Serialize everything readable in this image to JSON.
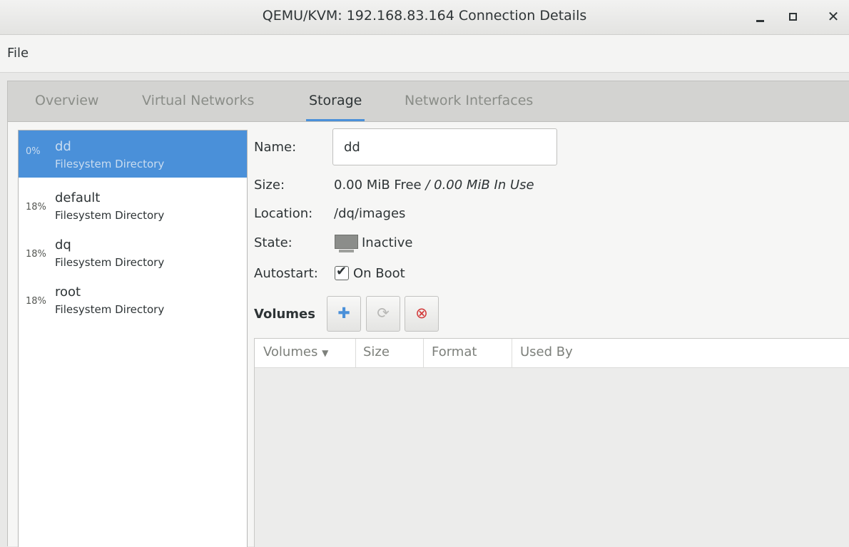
{
  "window": {
    "title": "QEMU/KVM: 192.168.83.164 Connection Details"
  },
  "menu": {
    "file": "File"
  },
  "tabs": [
    {
      "label": "Overview",
      "active": false
    },
    {
      "label": "Virtual Networks",
      "active": false
    },
    {
      "label": "Storage",
      "active": true
    },
    {
      "label": "Network Interfaces",
      "active": false
    }
  ],
  "pools": [
    {
      "usage": "0%",
      "name": "dd",
      "type": "Filesystem Directory",
      "selected": true
    },
    {
      "usage": "18%",
      "name": "default",
      "type": "Filesystem Directory",
      "selected": false
    },
    {
      "usage": "18%",
      "name": "dq",
      "type": "Filesystem Directory",
      "selected": false
    },
    {
      "usage": "18%",
      "name": "root",
      "type": "Filesystem Directory",
      "selected": false
    }
  ],
  "details": {
    "name_label": "Name:",
    "name_value": "dd",
    "size_label": "Size:",
    "size_free": "0.00 MiB Free",
    "size_inuse": " / 0.00 MiB In Use",
    "location_label": "Location:",
    "location_value": "/dq/images",
    "state_label": "State:",
    "state_value": "Inactive",
    "autostart_label": "Autostart:",
    "autostart_value": "On Boot",
    "autostart_checked": true
  },
  "volumes": {
    "label": "Volumes",
    "columns": [
      "Volumes",
      "Size",
      "Format",
      "Used By"
    ],
    "rows": []
  },
  "colors": {
    "accent": "#4a90d9",
    "delete": "#d33a3a",
    "add": "#4a90d9"
  }
}
